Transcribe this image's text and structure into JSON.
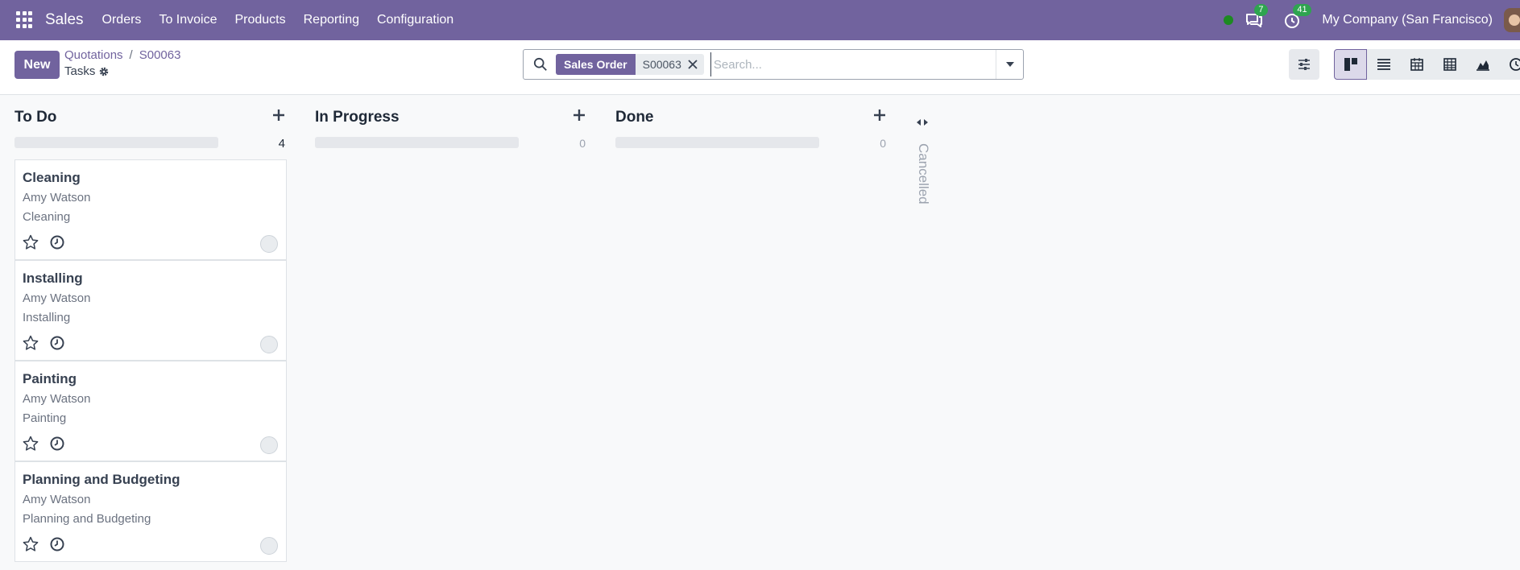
{
  "navbar": {
    "app_name": "Sales",
    "menu": [
      "Orders",
      "To Invoice",
      "Products",
      "Reporting",
      "Configuration"
    ],
    "messages_count": "7",
    "activities_count": "41",
    "company": "My Company (San Francisco)"
  },
  "control": {
    "new_label": "New",
    "breadcrumb_parent": "Quotations",
    "breadcrumb_sep": "/",
    "breadcrumb_record": "S00063",
    "title": "Tasks",
    "search": {
      "facet_label": "Sales Order",
      "facet_value": "S00063",
      "placeholder": "Search..."
    }
  },
  "columns": [
    {
      "title": "To Do",
      "count": "4"
    },
    {
      "title": "In Progress",
      "count": "0"
    },
    {
      "title": "Done",
      "count": "0"
    }
  ],
  "cards": [
    {
      "title": "Cleaning",
      "assignee": "Amy Watson",
      "description": "Cleaning"
    },
    {
      "title": "Installing",
      "assignee": "Amy Watson",
      "description": "Installing"
    },
    {
      "title": "Painting",
      "assignee": "Amy Watson",
      "description": "Painting"
    },
    {
      "title": "Planning and Budgeting",
      "assignee": "Amy Watson",
      "description": "Planning and Budgeting"
    }
  ],
  "folded_column": "Cancelled",
  "colors": {
    "brand": "#71639e",
    "presence": "#1d8a22",
    "badge": "#2ea44f"
  },
  "icons": [
    "apps-icon",
    "chat-icon",
    "activity-clock-icon",
    "search-icon",
    "close-icon",
    "caret-down-icon",
    "filters-icon",
    "kanban-view-icon",
    "list-view-icon",
    "calendar-view-icon",
    "pivot-view-icon",
    "graph-view-icon",
    "activity-view-icon",
    "plus-icon",
    "star-icon",
    "clock-icon",
    "fold-arrows-icon",
    "gear-icon"
  ]
}
